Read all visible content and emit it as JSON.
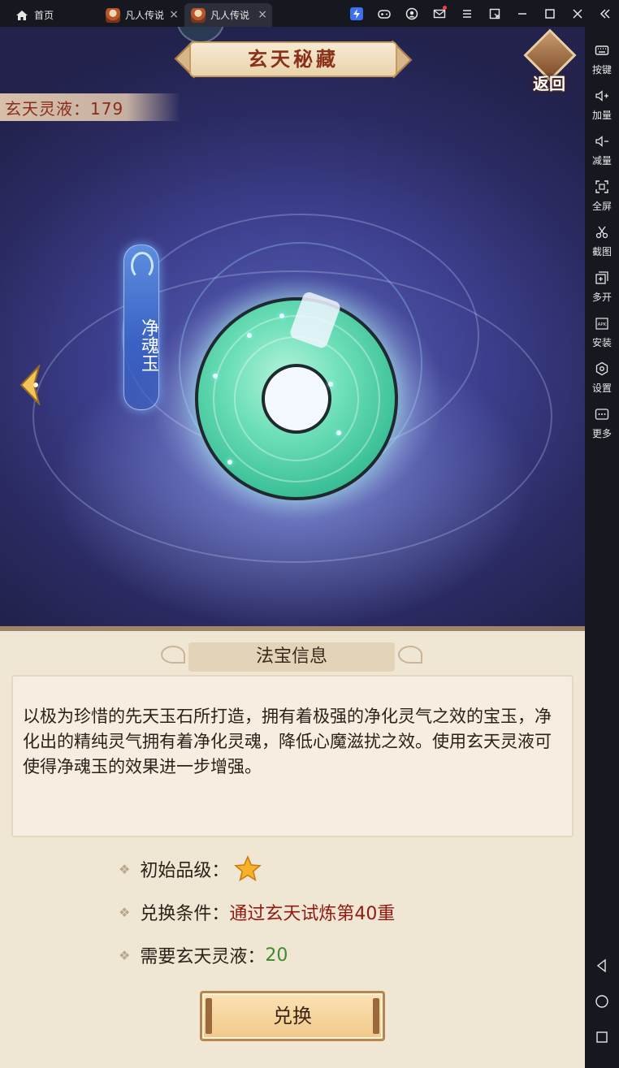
{
  "window": {
    "tabs": [
      {
        "label": "首页"
      },
      {
        "label": "凡人传说"
      },
      {
        "label": "凡人传说"
      }
    ]
  },
  "sidebar": {
    "items": [
      {
        "label": "按键",
        "icon": "keyboard-icon"
      },
      {
        "label": "加量",
        "icon": "volume-up-icon"
      },
      {
        "label": "减量",
        "icon": "volume-down-icon"
      },
      {
        "label": "全屏",
        "icon": "fullscreen-icon"
      },
      {
        "label": "截图",
        "icon": "scissors-icon"
      },
      {
        "label": "多开",
        "icon": "multi-instance-icon"
      },
      {
        "label": "安装",
        "icon": "apk-install-icon"
      },
      {
        "label": "设置",
        "icon": "gear-icon"
      },
      {
        "label": "更多",
        "icon": "more-icon"
      }
    ]
  },
  "game": {
    "title": "玄天秘藏",
    "back_label": "返回",
    "currency": "玄天灵液：179",
    "item_name": "净魂玉",
    "info_title": "法宝信息",
    "description": "以极为珍惜的先天玉石所打造，拥有着极强的净化灵气之效的宝玉，净化出的精纯灵气拥有着净化灵魂，降低心魔滋扰之效。使用玄天灵液可使得净魂玉的效果进一步增强。",
    "attributes": {
      "grade_label": "初始品级：",
      "grade_stars": 1,
      "condition_label": "兑换条件：",
      "condition_value": "通过玄天试炼第40重",
      "cost_label": "需要玄天灵液：",
      "cost_value": "20"
    },
    "exchange_label": "兑换"
  },
  "colors": {
    "accent_red": "#8f1a12",
    "accent_green": "#3f8a2d",
    "panel_bg": "#efe6d3",
    "emulator_bg": "#16181f"
  }
}
